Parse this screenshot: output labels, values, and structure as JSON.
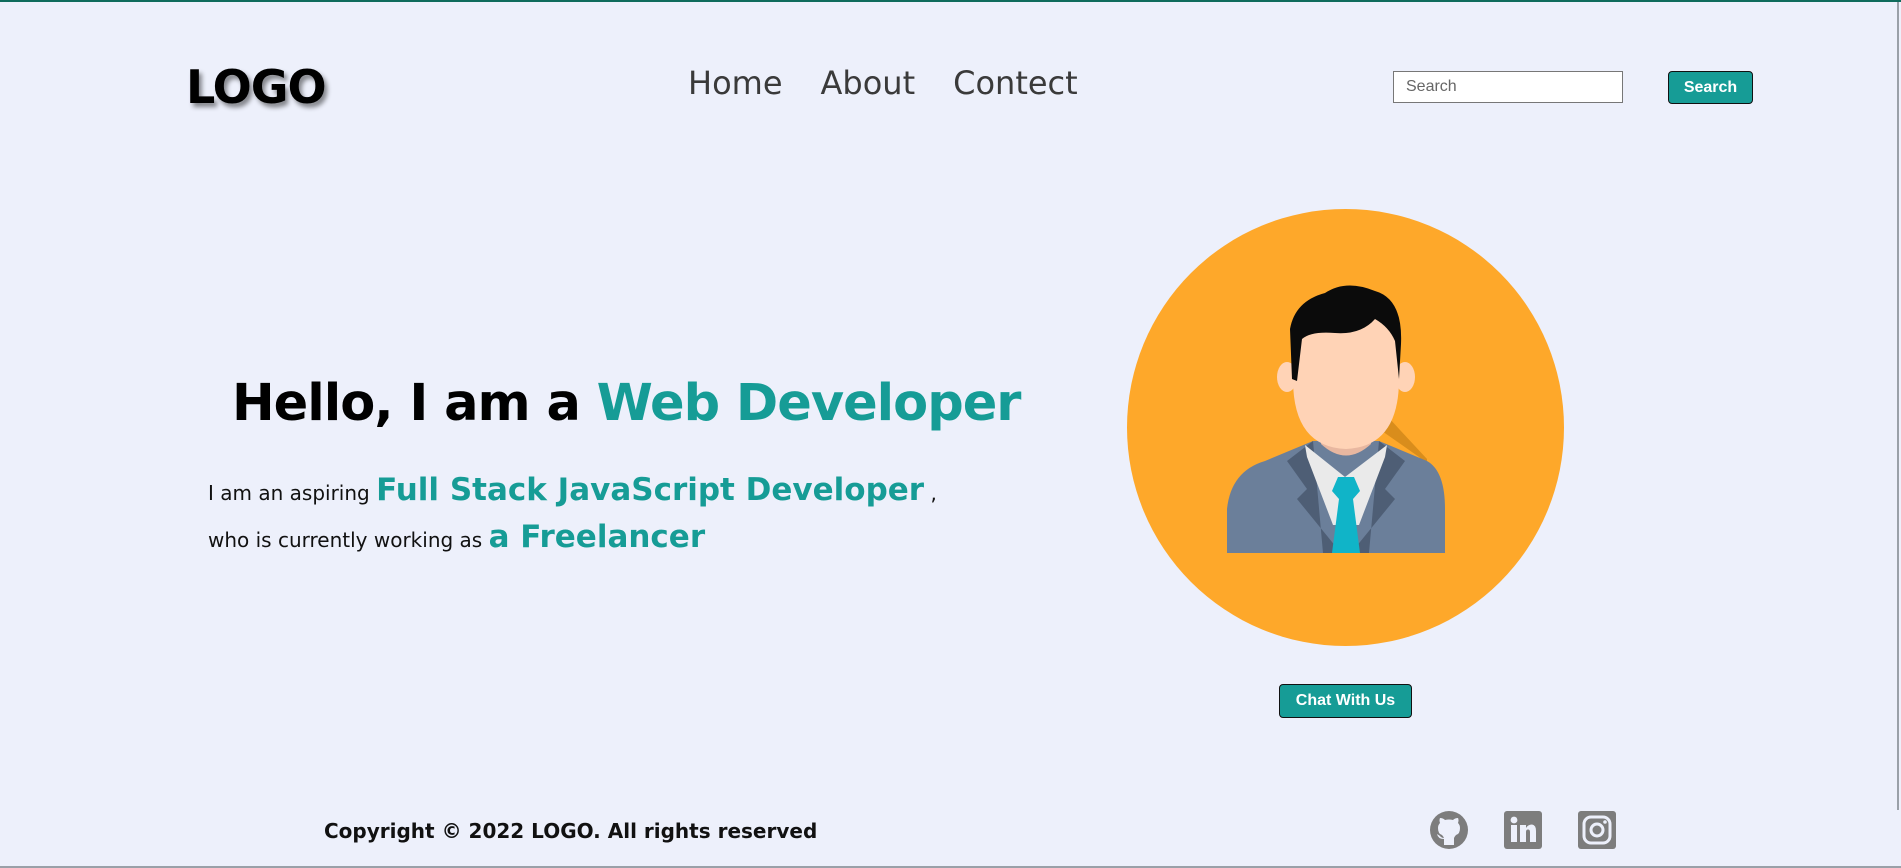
{
  "header": {
    "logo": "LOGO",
    "nav": [
      "Home",
      "About",
      "Contect"
    ],
    "search": {
      "placeholder": "Search",
      "value": "",
      "button_label": "Search"
    }
  },
  "hero": {
    "title_prefix": "Hello, I am a ",
    "title_accent": "Web Developer",
    "line1_prefix": "I am an aspiring ",
    "line1_accent": "Full Stack JavaScript Developer",
    "line1_suffix": " ,",
    "line2_prefix": "who is currently working as ",
    "line2_accent": "a Freelancer",
    "chat_button": "Chat With Us"
  },
  "footer": {
    "copyright": "Copyright © 2022 LOGO. All rights reserved",
    "social_icons": [
      "github-icon",
      "linkedin-icon",
      "instagram-icon"
    ]
  },
  "colors": {
    "background": "#edf0fb",
    "accent": "#169c96",
    "avatar_circle": "#fea82a",
    "icon_gray": "#7d7d7d"
  }
}
